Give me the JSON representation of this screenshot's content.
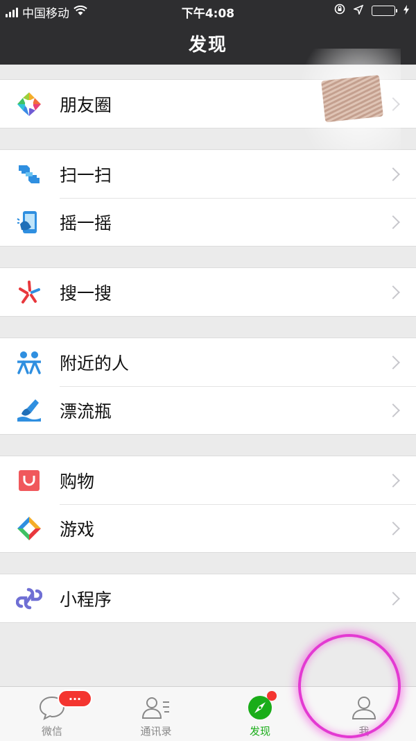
{
  "status_bar": {
    "carrier": "中国移动",
    "time": "下午4:08"
  },
  "nav": {
    "title": "发现"
  },
  "groups": [
    {
      "items": [
        {
          "label": "朋友圈",
          "icon": "moments-icon"
        }
      ]
    },
    {
      "items": [
        {
          "label": "扫一扫",
          "icon": "scan-icon"
        },
        {
          "label": "摇一摇",
          "icon": "shake-icon"
        }
      ]
    },
    {
      "items": [
        {
          "label": "搜一搜",
          "icon": "search-icon"
        }
      ]
    },
    {
      "items": [
        {
          "label": "附近的人",
          "icon": "people-nearby-icon"
        },
        {
          "label": "漂流瓶",
          "icon": "drift-bottle-icon"
        }
      ]
    },
    {
      "items": [
        {
          "label": "购物",
          "icon": "shopping-icon"
        },
        {
          "label": "游戏",
          "icon": "games-icon"
        }
      ]
    },
    {
      "items": [
        {
          "label": "小程序",
          "icon": "mini-program-icon"
        }
      ]
    }
  ],
  "tabbar": {
    "tabs": [
      {
        "label": "微信",
        "icon": "chat-bubble-icon",
        "badge": "···"
      },
      {
        "label": "通讯录",
        "icon": "contacts-icon"
      },
      {
        "label": "发现",
        "icon": "compass-icon",
        "active": true
      },
      {
        "label": "我",
        "icon": "person-icon"
      }
    ]
  },
  "colors": {
    "bar_bg": "#2e2e30",
    "page_bg": "#ebebeb",
    "active_green": "#1aad19",
    "badge_red": "#f43530",
    "annotation_pink": "#e33ad2"
  }
}
